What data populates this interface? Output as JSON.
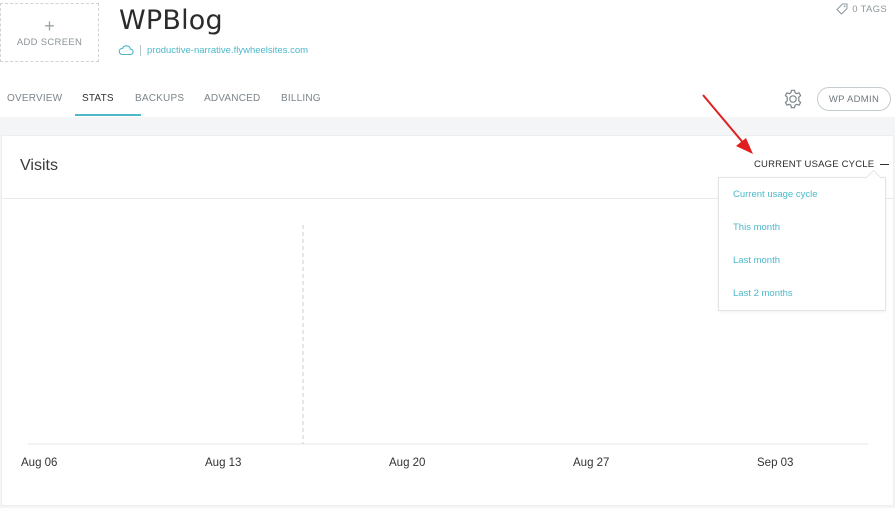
{
  "header": {
    "add_screen_plus": "+",
    "add_screen_label": "ADD SCREEN",
    "site_title": "WPBlog",
    "site_url": "productive-narrative.flywheelsites.com",
    "tags_label": "0 TAGS"
  },
  "tabs": [
    {
      "label": "OVERVIEW",
      "active": false
    },
    {
      "label": "STATS",
      "active": true
    },
    {
      "label": "BACKUPS",
      "active": false
    },
    {
      "label": "ADVANCED",
      "active": false
    },
    {
      "label": "BILLING",
      "active": false
    }
  ],
  "toolbar": {
    "settings_icon": "gear-icon",
    "wp_admin_label": "WP ADMIN"
  },
  "panel": {
    "title": "Visits",
    "cycle_button_label": "CURRENT USAGE CYCLE",
    "dropdown_options": [
      "Current usage cycle",
      "This month",
      "Last month",
      "Last 2 months"
    ]
  },
  "chart_data": {
    "type": "line",
    "title": "Visits",
    "x_tick_labels": [
      "Aug 06",
      "Aug 13",
      "Aug 20",
      "Aug 27",
      "Sep 03"
    ],
    "series": [],
    "marker_line_date": "Aug 16",
    "grid": false
  },
  "colors": {
    "accent": "#4cb8c9",
    "annotation_arrow": "#e02020"
  }
}
